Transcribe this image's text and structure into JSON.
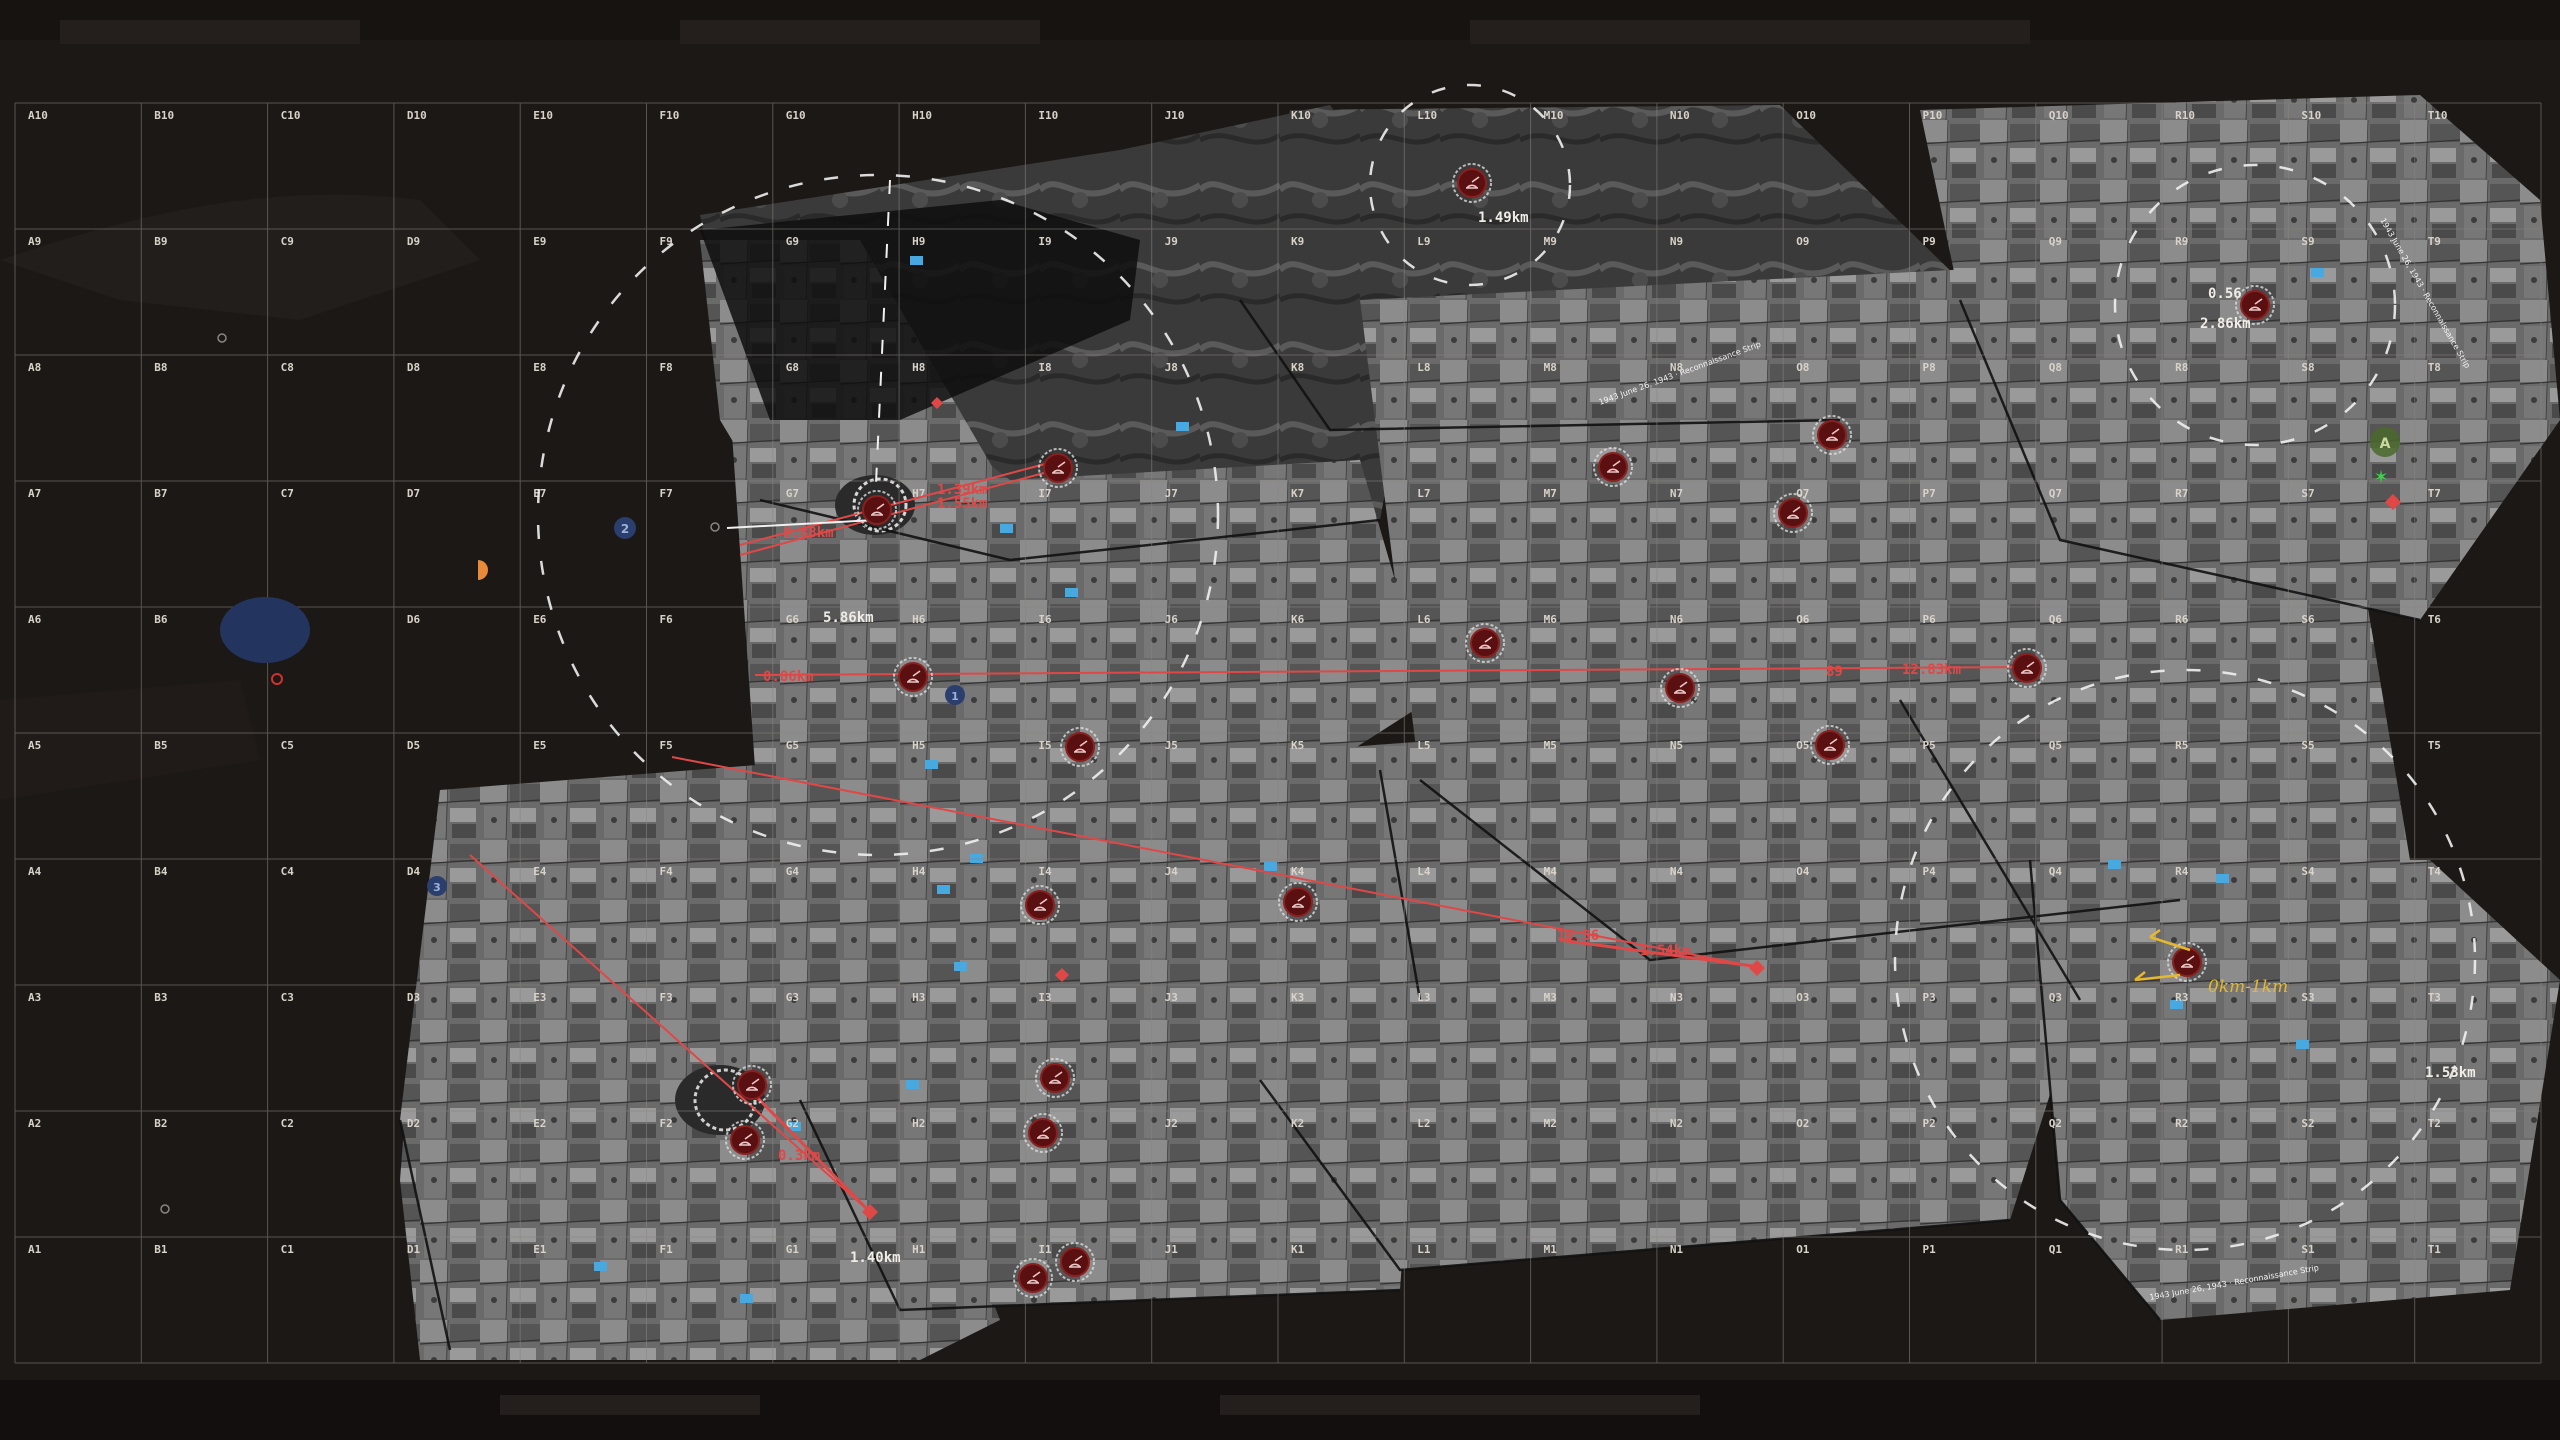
{
  "map": {
    "columns": [
      "A",
      "B",
      "C",
      "D",
      "E",
      "F",
      "G",
      "H",
      "I",
      "J",
      "K",
      "L",
      "M",
      "N",
      "O",
      "P",
      "Q",
      "R",
      "S",
      "T"
    ],
    "rows": [
      10,
      9,
      8,
      7,
      6,
      5,
      4,
      3,
      2,
      1
    ],
    "colors": {
      "background": "#1c1816",
      "grid_line": "#8a8580",
      "artillery_marker": "#7a1414",
      "distance_line": "#e04848",
      "friendly_marker": "#2a3f6e",
      "objective_marker": "#4a6a2a",
      "annotation_yellow": "#e6b82e",
      "supply_marker": "#48a8e0"
    }
  },
  "distance_labels": [
    {
      "id": "d1",
      "text": "1.49km",
      "color": "white"
    },
    {
      "id": "d2",
      "text": "0.56",
      "color": "white"
    },
    {
      "id": "d3",
      "text": "2.86km",
      "color": "white"
    },
    {
      "id": "d4",
      "text": "1.39km",
      "color": "red"
    },
    {
      "id": "d5",
      "text": "1.55km",
      "color": "red"
    },
    {
      "id": "d6",
      "text": "0.88km",
      "color": "red"
    },
    {
      "id": "d7",
      "text": "5.86km",
      "color": "white"
    },
    {
      "id": "d8",
      "text": "0.86km",
      "color": "red"
    },
    {
      "id": "d9",
      "text": "89",
      "color": "red"
    },
    {
      "id": "d10",
      "text": "12.83km",
      "color": "red"
    },
    {
      "id": "d11",
      "text": "10.36",
      "color": "red"
    },
    {
      "id": "d12",
      "text": "1.54km",
      "color": "red"
    },
    {
      "id": "d13",
      "text": "0.3km",
      "color": "red"
    },
    {
      "id": "d14",
      "text": "1.40km",
      "color": "white"
    },
    {
      "id": "d15",
      "text": "1.53km",
      "color": "white"
    }
  ],
  "yellow_annotation": "0km-1km",
  "markers": {
    "objective_letter": "A",
    "friendly_numbers": [
      "1",
      "2",
      "3"
    ]
  },
  "photo_caption": "1943 June 26, 1943 · Reconnaissance Strip"
}
